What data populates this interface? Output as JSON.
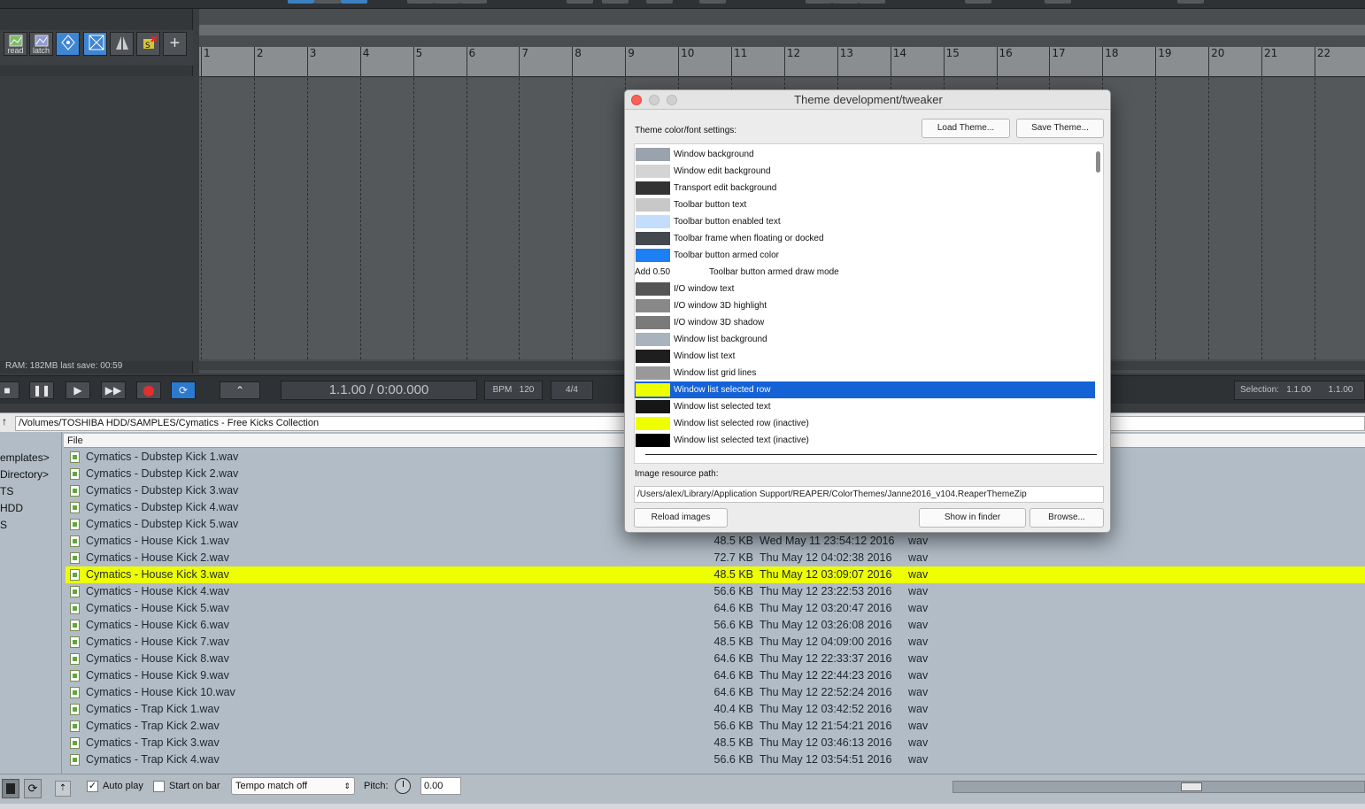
{
  "tcp": {
    "toolbar": [
      {
        "icon": "read-icon",
        "label": "read"
      },
      {
        "icon": "latch-icon",
        "label": "latch"
      },
      {
        "icon": "envelope-points-icon",
        "label": ""
      },
      {
        "icon": "crossfade-icon",
        "label": ""
      },
      {
        "icon": "split-icon",
        "label": ""
      },
      {
        "icon": "snap-icon",
        "label": ""
      },
      {
        "icon": "add-icon",
        "label": "+"
      }
    ],
    "status": "RAM: 182MB  last save: 00:59"
  },
  "ruler": {
    "marks": [
      "1",
      "2",
      "3",
      "4",
      "5",
      "6",
      "7",
      "8",
      "9",
      "10",
      "11",
      "12",
      "13",
      "14",
      "15",
      "16",
      "17",
      "18",
      "19",
      "20",
      "21",
      "22"
    ]
  },
  "transport": {
    "position": "1.1.00 / 0:00.000",
    "bpm_label": "BPM",
    "bpm": "120",
    "time_sig": "4/4",
    "selection_label": "Selection:",
    "selection_start": "1.1.00",
    "selection_end": "1.1.00"
  },
  "browser": {
    "path": "/Volumes/TOSHIBA HDD/SAMPLES/Cymatics - Free Kicks Collection",
    "column_file": "File",
    "dirs": [
      "emplates>",
      "Directory>",
      "TS",
      " HDD",
      "S"
    ],
    "files": [
      {
        "name": "Cymatics - Dubstep Kick 1.wav",
        "size": "",
        "date": "",
        "type": ""
      },
      {
        "name": "Cymatics - Dubstep Kick 2.wav",
        "size": "",
        "date": "",
        "type": ""
      },
      {
        "name": "Cymatics - Dubstep Kick 3.wav",
        "size": "",
        "date": "",
        "type": ""
      },
      {
        "name": "Cymatics - Dubstep Kick 4.wav",
        "size": "",
        "date": "",
        "type": ""
      },
      {
        "name": "Cymatics - Dubstep Kick 5.wav",
        "size": "",
        "date": "",
        "type": ""
      },
      {
        "name": "Cymatics - House Kick 1.wav",
        "size": "48.5 KB",
        "date": "Wed May 11 23:54:12 2016",
        "type": "wav"
      },
      {
        "name": "Cymatics - House Kick 2.wav",
        "size": "72.7 KB",
        "date": "Thu May 12 04:02:38 2016",
        "type": "wav"
      },
      {
        "name": "Cymatics - House Kick 3.wav",
        "size": "48.5 KB",
        "date": "Thu May 12 03:09:07 2016",
        "type": "wav",
        "selected": true
      },
      {
        "name": "Cymatics - House Kick 4.wav",
        "size": "56.6 KB",
        "date": "Thu May 12 23:22:53 2016",
        "type": "wav"
      },
      {
        "name": "Cymatics - House Kick 5.wav",
        "size": "64.6 KB",
        "date": "Thu May 12 03:20:47 2016",
        "type": "wav"
      },
      {
        "name": "Cymatics - House Kick 6.wav",
        "size": "56.6 KB",
        "date": "Thu May 12 03:26:08 2016",
        "type": "wav"
      },
      {
        "name": "Cymatics - House Kick 7.wav",
        "size": "48.5 KB",
        "date": "Thu May 12 04:09:00 2016",
        "type": "wav"
      },
      {
        "name": "Cymatics - House Kick 8.wav",
        "size": "64.6 KB",
        "date": "Thu May 12 22:33:37 2016",
        "type": "wav"
      },
      {
        "name": "Cymatics - House Kick 9.wav",
        "size": "64.6 KB",
        "date": "Thu May 12 22:44:23 2016",
        "type": "wav"
      },
      {
        "name": "Cymatics - House Kick 10.wav",
        "size": "64.6 KB",
        "date": "Thu May 12 22:52:24 2016",
        "type": "wav"
      },
      {
        "name": "Cymatics - Trap Kick 1.wav",
        "size": "40.4 KB",
        "date": "Thu May 12 03:42:52 2016",
        "type": "wav"
      },
      {
        "name": "Cymatics - Trap Kick 2.wav",
        "size": "56.6 KB",
        "date": "Thu May 12 21:54:21 2016",
        "type": "wav"
      },
      {
        "name": "Cymatics - Trap Kick 3.wav",
        "size": "48.5 KB",
        "date": "Thu May 12 03:46:13 2016",
        "type": "wav"
      },
      {
        "name": "Cymatics - Trap Kick 4.wav",
        "size": "56.6 KB",
        "date": "Thu May 12 03:54:51 2016",
        "type": "wav"
      }
    ],
    "selected_color": "#eeff00"
  },
  "bottom": {
    "auto_play_label": "Auto play",
    "auto_play_checked": true,
    "start_on_bar_label": "Start on bar",
    "start_on_bar_checked": false,
    "tempo_match": "Tempo match off",
    "pitch_label": "Pitch:",
    "pitch_value": "0.00"
  },
  "dialog": {
    "title": "Theme development/tweaker",
    "settings_label": "Theme color/font settings:",
    "load_button": "Load Theme...",
    "save_button": "Save Theme...",
    "rows": [
      {
        "label": "Window background",
        "color": "#9aa3ad"
      },
      {
        "label": "Window edit background",
        "color": "#d4d4d4"
      },
      {
        "label": "Transport edit background",
        "color": "#333333"
      },
      {
        "label": "Toolbar button text",
        "color": "#c8c8c8"
      },
      {
        "label": "Toolbar button enabled text",
        "color": "#c4ddfc"
      },
      {
        "label": "Toolbar frame when floating or docked",
        "color": "#43494f"
      },
      {
        "label": "Toolbar button armed color",
        "color": "#1d7ff4"
      },
      {
        "label": "Toolbar button armed draw mode",
        "prefix": "Add 0.50"
      },
      {
        "label": "I/O window text",
        "color": "#555555"
      },
      {
        "label": "I/O window 3D highlight",
        "color": "#888888"
      },
      {
        "label": "I/O window 3D shadow",
        "color": "#7a7a7a"
      },
      {
        "label": "Window list background",
        "color": "#a8b3bd"
      },
      {
        "label": "Window list text",
        "color": "#1e1e1e"
      },
      {
        "label": "Window list grid lines",
        "color": "#999999"
      },
      {
        "label": "Window list selected row",
        "color": "#eeff00",
        "selected": true
      },
      {
        "label": "Window list selected text",
        "color": "#161616"
      },
      {
        "label": "Window list selected row (inactive)",
        "color": "#eeff00"
      },
      {
        "label": "Window list selected text (inactive)",
        "color": "#000000"
      }
    ],
    "resource_label": "Image resource path:",
    "resource_path": "/Users/alex/Library/Application Support/REAPER/ColorThemes/Janne2016_v104.ReaperThemeZip",
    "reload_button": "Reload images",
    "show_finder_button": "Show in finder",
    "browse_button": "Browse..."
  }
}
